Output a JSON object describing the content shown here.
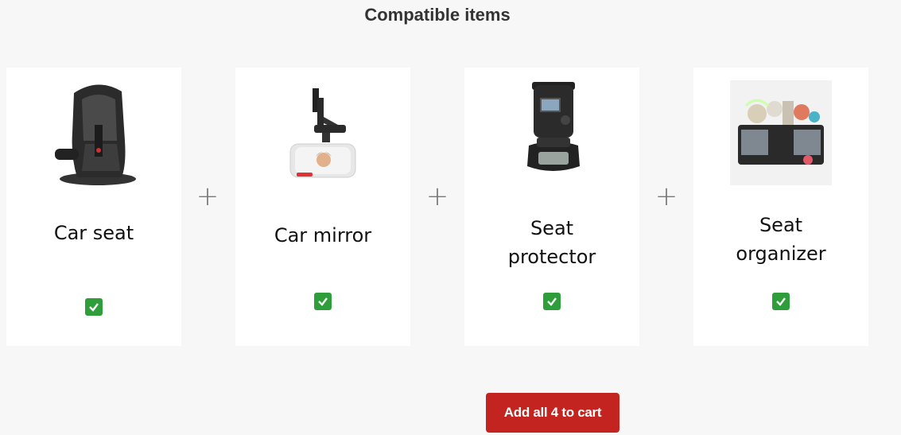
{
  "section": {
    "title": "Compatible items"
  },
  "items": [
    {
      "name": "Car seat",
      "icon": "car-seat-image",
      "checked": true
    },
    {
      "name": "Car mirror",
      "icon": "car-mirror-image",
      "checked": true
    },
    {
      "name": "Seat\nprotector",
      "icon": "seat-protector-image",
      "checked": true
    },
    {
      "name": "Seat\norganizer",
      "icon": "seat-organizer-image",
      "checked": true
    }
  ],
  "separator": "+",
  "cart_button": {
    "label": "Add all 4 to cart"
  },
  "colors": {
    "check": "#2e9e3a",
    "cta": "#c4241f",
    "background": "#f7f7f7"
  }
}
